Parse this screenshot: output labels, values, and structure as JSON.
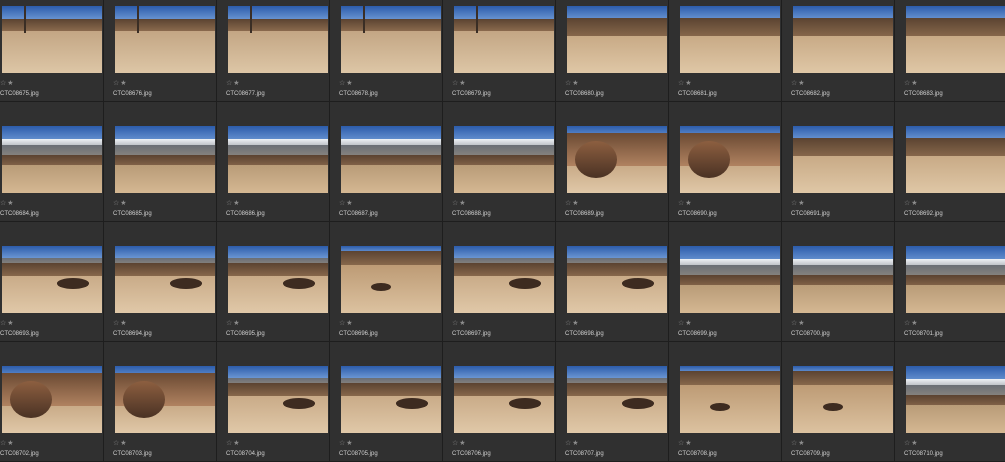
{
  "grid": {
    "rows": [
      {
        "items": [
          {
            "filename": "CTC08675.jpg",
            "scene": "road"
          },
          {
            "filename": "CTC08676.jpg",
            "scene": "road"
          },
          {
            "filename": "CTC08677.jpg",
            "scene": "road"
          },
          {
            "filename": "CTC08678.jpg",
            "scene": "road"
          },
          {
            "filename": "CTC08679.jpg",
            "scene": "road"
          },
          {
            "filename": "CTC08680.jpg",
            "scene": "hills"
          },
          {
            "filename": "CTC08681.jpg",
            "scene": "hills"
          },
          {
            "filename": "CTC08682.jpg",
            "scene": "hills"
          },
          {
            "filename": "CTC08683.jpg",
            "scene": "hills"
          }
        ]
      },
      {
        "items": [
          {
            "filename": "CTC08684.jpg",
            "scene": "snow"
          },
          {
            "filename": "CTC08685.jpg",
            "scene": "snow"
          },
          {
            "filename": "CTC08686.jpg",
            "scene": "snow"
          },
          {
            "filename": "CTC08687.jpg",
            "scene": "snow"
          },
          {
            "filename": "CTC08688.jpg",
            "scene": "snow"
          },
          {
            "filename": "CTC08689.jpg",
            "scene": "boulder"
          },
          {
            "filename": "CTC08690.jpg",
            "scene": "boulder"
          },
          {
            "filename": "CTC08691.jpg",
            "scene": "hills"
          },
          {
            "filename": "CTC08692.jpg",
            "scene": "hills"
          }
        ]
      },
      {
        "items": [
          {
            "filename": "CTC08693.jpg",
            "scene": "valley"
          },
          {
            "filename": "CTC08694.jpg",
            "scene": "valley"
          },
          {
            "filename": "CTC08695.jpg",
            "scene": "valley"
          },
          {
            "filename": "CTC08696.jpg",
            "scene": "dune"
          },
          {
            "filename": "CTC08697.jpg",
            "scene": "valley"
          },
          {
            "filename": "CTC08698.jpg",
            "scene": "valley"
          },
          {
            "filename": "CTC08699.jpg",
            "scene": "snow"
          },
          {
            "filename": "CTC08700.jpg",
            "scene": "snow"
          },
          {
            "filename": "CTC08701.jpg",
            "scene": "snow"
          }
        ]
      },
      {
        "items": [
          {
            "filename": "CTC08702.jpg",
            "scene": "boulder"
          },
          {
            "filename": "CTC08703.jpg",
            "scene": "boulder"
          },
          {
            "filename": "CTC08704.jpg",
            "scene": "valley"
          },
          {
            "filename": "CTC08705.jpg",
            "scene": "valley"
          },
          {
            "filename": "CTC08706.jpg",
            "scene": "valley"
          },
          {
            "filename": "CTC08707.jpg",
            "scene": "valley"
          },
          {
            "filename": "CTC08708.jpg",
            "scene": "dune"
          },
          {
            "filename": "CTC08709.jpg",
            "scene": "dune"
          },
          {
            "filename": "CTC08710.jpg",
            "scene": "snow"
          }
        ]
      }
    ]
  },
  "rating": {
    "glyph": "☆★",
    "value": 0
  },
  "colors": {
    "background": "#262626",
    "cell": "#303030",
    "text": "#cfcfcf",
    "sky": "#2c5cab"
  },
  "icons": {
    "rating": "star-rating-icon"
  }
}
